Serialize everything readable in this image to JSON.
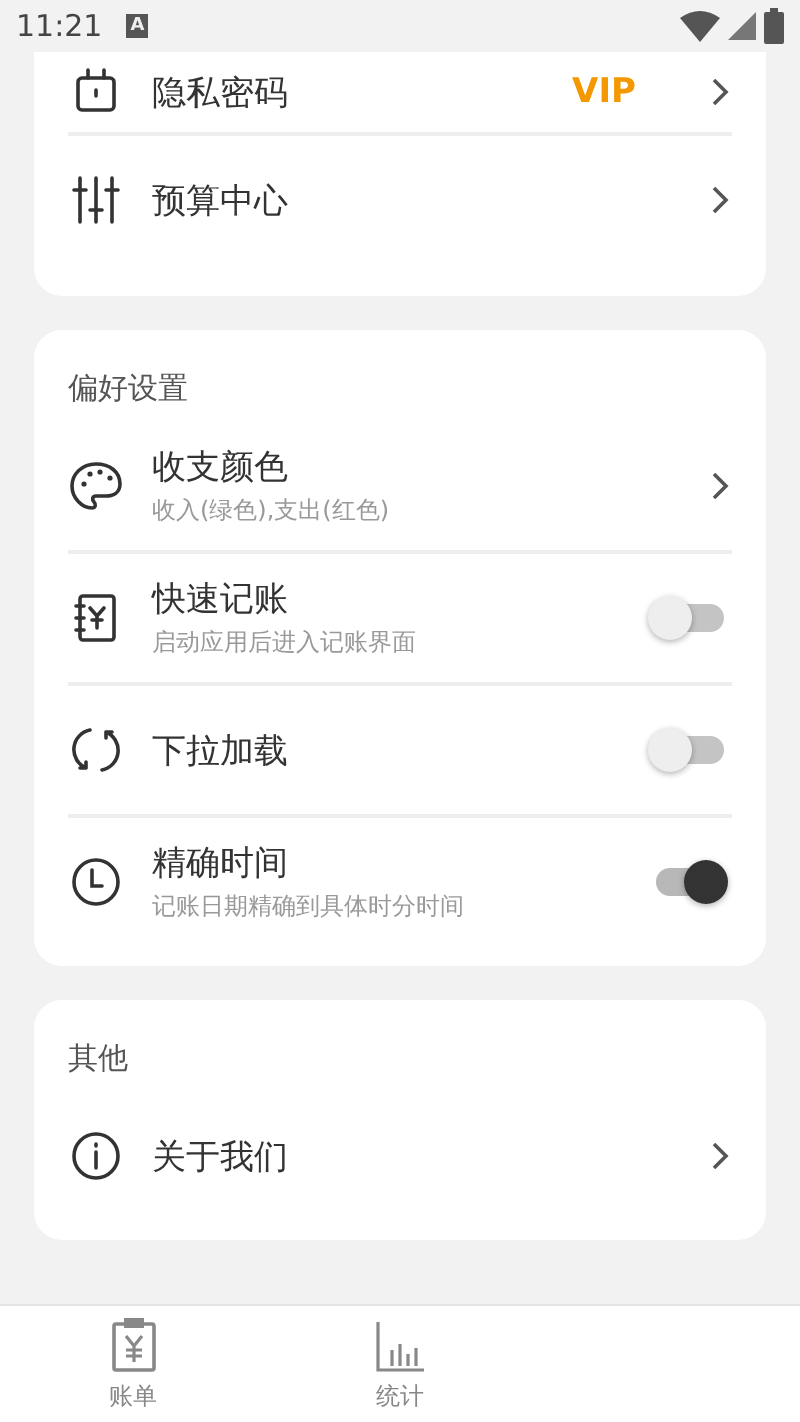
{
  "status_bar": {
    "time": "11:21",
    "badge": "A"
  },
  "sections": [
    {
      "items": [
        {
          "kind": "link",
          "title": "隐私密码",
          "tag": "VIP"
        },
        {
          "kind": "link",
          "title": "预算中心"
        }
      ]
    },
    {
      "header": "偏好设置",
      "items": [
        {
          "kind": "link",
          "title": "收支颜色",
          "subtitle": "收入(绿色),支出(红色)"
        },
        {
          "kind": "toggle",
          "title": "快速记账",
          "subtitle": "启动应用后进入记账界面",
          "on": false
        },
        {
          "kind": "toggle",
          "title": "下拉加载",
          "on": false
        },
        {
          "kind": "toggle",
          "title": "精确时间",
          "subtitle": "记账日期精确到具体时分时间",
          "on": true
        }
      ]
    },
    {
      "header": "其他",
      "items": [
        {
          "kind": "link",
          "title": "关于我们"
        }
      ]
    }
  ],
  "bottom_nav": [
    {
      "label": "账单"
    },
    {
      "label": "统计"
    }
  ]
}
